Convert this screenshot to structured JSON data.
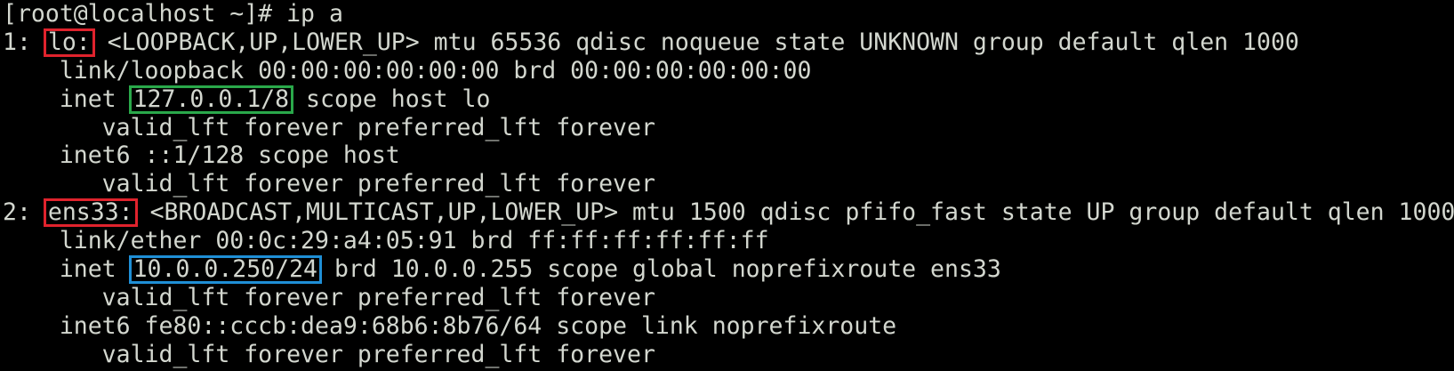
{
  "terminal": {
    "prompt": "[root@localhost ~]# ",
    "command": "ip a",
    "highlight_colors": {
      "interface_name": "#e0232d",
      "loopback_address": "#2aa84a",
      "ipv4_address": "#1f8fd6"
    },
    "interfaces": [
      {
        "index": "1: ",
        "name": "lo:",
        "header_rest": " <LOOPBACK,UP,LOWER_UP> mtu 65536 qdisc noqueue state UNKNOWN group default qlen 1000",
        "link": "    link/loopback 00:00:00:00:00:00 brd 00:00:00:00:00:00",
        "inet_prefix": "    inet ",
        "inet_addr": "127.0.0.1/8",
        "inet_rest": " scope host lo",
        "inet_valid": "       valid_lft forever preferred_lft forever",
        "inet6": "    inet6 ::1/128 scope host",
        "inet6_valid": "       valid_lft forever preferred_lft forever"
      },
      {
        "index": "2: ",
        "name": "ens33:",
        "header_rest": " <BROADCAST,MULTICAST,UP,LOWER_UP> mtu 1500 qdisc pfifo_fast state UP group default qlen 1000",
        "link": "    link/ether 00:0c:29:a4:05:91 brd ff:ff:ff:ff:ff:ff",
        "inet_prefix": "    inet ",
        "inet_addr": "10.0.0.250/24",
        "inet_rest": " brd 10.0.0.255 scope global noprefixroute ens33",
        "inet_valid": "       valid_lft forever preferred_lft forever",
        "inet6": "    inet6 fe80::cccb:dea9:68b6:8b76/64 scope link noprefixroute",
        "inet6_valid": "       valid_lft forever preferred_lft forever"
      }
    ]
  }
}
